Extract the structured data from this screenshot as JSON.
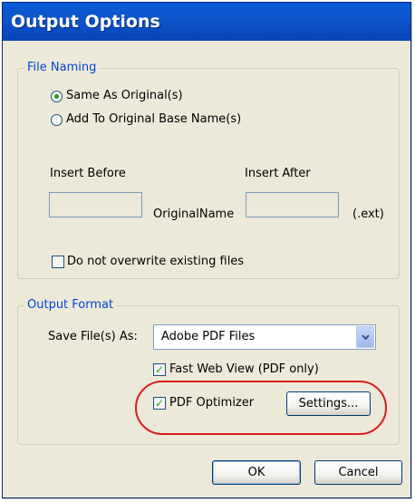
{
  "window": {
    "title": "Output Options"
  },
  "file_naming": {
    "legend": "File Naming",
    "radio_same": "Same As Original(s)",
    "radio_add": "Add To Original Base Name(s)",
    "insert_before_label": "Insert Before",
    "insert_after_label": "Insert After",
    "original_name_label": "OriginalName",
    "ext_label": "(.ext)",
    "insert_before_value": "",
    "insert_after_value": "",
    "overwrite_label": "Do not overwrite existing files",
    "overwrite_checked": false,
    "selected_option": "same"
  },
  "output_format": {
    "legend": "Output Format",
    "save_as_label": "Save File(s) As:",
    "save_as_value": "Adobe PDF Files",
    "fast_web_view_label": "Fast Web View (PDF only)",
    "fast_web_view_checked": true,
    "pdf_optimizer_label": "PDF Optimizer",
    "pdf_optimizer_checked": true,
    "settings_button": "Settings..."
  },
  "buttons": {
    "ok": "OK",
    "cancel": "Cancel"
  },
  "colors": {
    "highlight": "#d81e1e",
    "title_bar": "#0845b8",
    "legend_text": "#0046d5"
  }
}
